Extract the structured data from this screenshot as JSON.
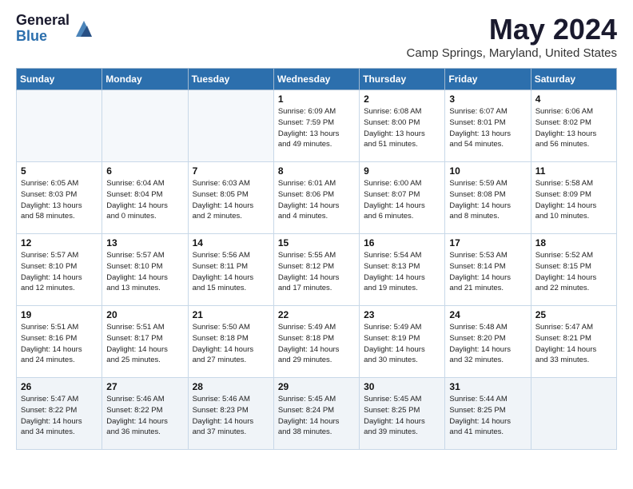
{
  "header": {
    "logo_general": "General",
    "logo_blue": "Blue",
    "month_title": "May 2024",
    "location": "Camp Springs, Maryland, United States"
  },
  "weekdays": [
    "Sunday",
    "Monday",
    "Tuesday",
    "Wednesday",
    "Thursday",
    "Friday",
    "Saturday"
  ],
  "weeks": [
    [
      {
        "day": "",
        "info": ""
      },
      {
        "day": "",
        "info": ""
      },
      {
        "day": "",
        "info": ""
      },
      {
        "day": "1",
        "info": "Sunrise: 6:09 AM\nSunset: 7:59 PM\nDaylight: 13 hours\nand 49 minutes."
      },
      {
        "day": "2",
        "info": "Sunrise: 6:08 AM\nSunset: 8:00 PM\nDaylight: 13 hours\nand 51 minutes."
      },
      {
        "day": "3",
        "info": "Sunrise: 6:07 AM\nSunset: 8:01 PM\nDaylight: 13 hours\nand 54 minutes."
      },
      {
        "day": "4",
        "info": "Sunrise: 6:06 AM\nSunset: 8:02 PM\nDaylight: 13 hours\nand 56 minutes."
      }
    ],
    [
      {
        "day": "5",
        "info": "Sunrise: 6:05 AM\nSunset: 8:03 PM\nDaylight: 13 hours\nand 58 minutes."
      },
      {
        "day": "6",
        "info": "Sunrise: 6:04 AM\nSunset: 8:04 PM\nDaylight: 14 hours\nand 0 minutes."
      },
      {
        "day": "7",
        "info": "Sunrise: 6:03 AM\nSunset: 8:05 PM\nDaylight: 14 hours\nand 2 minutes."
      },
      {
        "day": "8",
        "info": "Sunrise: 6:01 AM\nSunset: 8:06 PM\nDaylight: 14 hours\nand 4 minutes."
      },
      {
        "day": "9",
        "info": "Sunrise: 6:00 AM\nSunset: 8:07 PM\nDaylight: 14 hours\nand 6 minutes."
      },
      {
        "day": "10",
        "info": "Sunrise: 5:59 AM\nSunset: 8:08 PM\nDaylight: 14 hours\nand 8 minutes."
      },
      {
        "day": "11",
        "info": "Sunrise: 5:58 AM\nSunset: 8:09 PM\nDaylight: 14 hours\nand 10 minutes."
      }
    ],
    [
      {
        "day": "12",
        "info": "Sunrise: 5:57 AM\nSunset: 8:10 PM\nDaylight: 14 hours\nand 12 minutes."
      },
      {
        "day": "13",
        "info": "Sunrise: 5:57 AM\nSunset: 8:10 PM\nDaylight: 14 hours\nand 13 minutes."
      },
      {
        "day": "14",
        "info": "Sunrise: 5:56 AM\nSunset: 8:11 PM\nDaylight: 14 hours\nand 15 minutes."
      },
      {
        "day": "15",
        "info": "Sunrise: 5:55 AM\nSunset: 8:12 PM\nDaylight: 14 hours\nand 17 minutes."
      },
      {
        "day": "16",
        "info": "Sunrise: 5:54 AM\nSunset: 8:13 PM\nDaylight: 14 hours\nand 19 minutes."
      },
      {
        "day": "17",
        "info": "Sunrise: 5:53 AM\nSunset: 8:14 PM\nDaylight: 14 hours\nand 21 minutes."
      },
      {
        "day": "18",
        "info": "Sunrise: 5:52 AM\nSunset: 8:15 PM\nDaylight: 14 hours\nand 22 minutes."
      }
    ],
    [
      {
        "day": "19",
        "info": "Sunrise: 5:51 AM\nSunset: 8:16 PM\nDaylight: 14 hours\nand 24 minutes."
      },
      {
        "day": "20",
        "info": "Sunrise: 5:51 AM\nSunset: 8:17 PM\nDaylight: 14 hours\nand 25 minutes."
      },
      {
        "day": "21",
        "info": "Sunrise: 5:50 AM\nSunset: 8:18 PM\nDaylight: 14 hours\nand 27 minutes."
      },
      {
        "day": "22",
        "info": "Sunrise: 5:49 AM\nSunset: 8:18 PM\nDaylight: 14 hours\nand 29 minutes."
      },
      {
        "day": "23",
        "info": "Sunrise: 5:49 AM\nSunset: 8:19 PM\nDaylight: 14 hours\nand 30 minutes."
      },
      {
        "day": "24",
        "info": "Sunrise: 5:48 AM\nSunset: 8:20 PM\nDaylight: 14 hours\nand 32 minutes."
      },
      {
        "day": "25",
        "info": "Sunrise: 5:47 AM\nSunset: 8:21 PM\nDaylight: 14 hours\nand 33 minutes."
      }
    ],
    [
      {
        "day": "26",
        "info": "Sunrise: 5:47 AM\nSunset: 8:22 PM\nDaylight: 14 hours\nand 34 minutes."
      },
      {
        "day": "27",
        "info": "Sunrise: 5:46 AM\nSunset: 8:22 PM\nDaylight: 14 hours\nand 36 minutes."
      },
      {
        "day": "28",
        "info": "Sunrise: 5:46 AM\nSunset: 8:23 PM\nDaylight: 14 hours\nand 37 minutes."
      },
      {
        "day": "29",
        "info": "Sunrise: 5:45 AM\nSunset: 8:24 PM\nDaylight: 14 hours\nand 38 minutes."
      },
      {
        "day": "30",
        "info": "Sunrise: 5:45 AM\nSunset: 8:25 PM\nDaylight: 14 hours\nand 39 minutes."
      },
      {
        "day": "31",
        "info": "Sunrise: 5:44 AM\nSunset: 8:25 PM\nDaylight: 14 hours\nand 41 minutes."
      },
      {
        "day": "",
        "info": ""
      }
    ]
  ]
}
